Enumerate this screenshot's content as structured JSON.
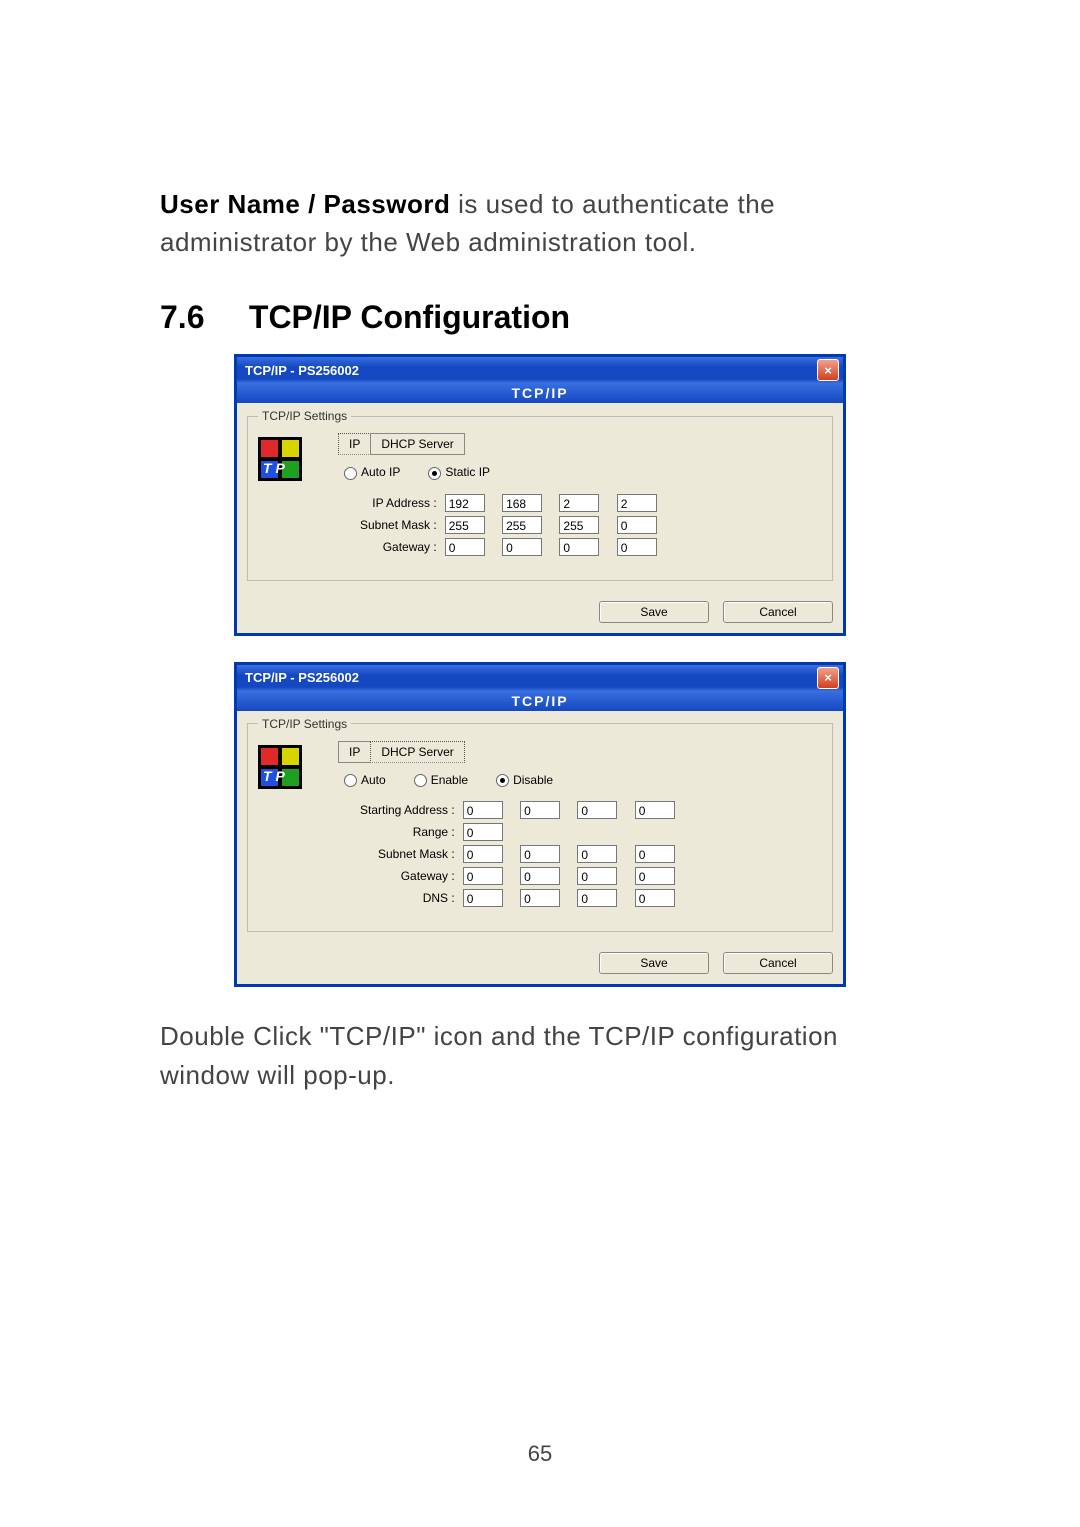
{
  "intro_bold": "User Name / Password",
  "intro_rest": " is used to authenticate the administrator by the Web administration tool.",
  "section": {
    "number": "7.6",
    "title": "TCP/IP Configuration"
  },
  "dialog1": {
    "title": "TCP/IP - PS256002",
    "close": "×",
    "header": "TCP/IP",
    "legend": "TCP/IP Settings",
    "tabs": [
      "IP",
      "DHCP Server"
    ],
    "active_tab": 0,
    "radios": [
      {
        "label": "Auto IP",
        "checked": false
      },
      {
        "label": "Static IP",
        "checked": true
      }
    ],
    "fields": [
      {
        "label": "IP Address :",
        "octets": [
          "192",
          "168",
          "2",
          "2"
        ]
      },
      {
        "label": "Subnet Mask :",
        "octets": [
          "255",
          "255",
          "255",
          "0"
        ]
      },
      {
        "label": "Gateway :",
        "octets": [
          "0",
          "0",
          "0",
          "0"
        ]
      }
    ],
    "save": "Save",
    "cancel": "Cancel"
  },
  "dialog2": {
    "title": "TCP/IP - PS256002",
    "close": "×",
    "header": "TCP/IP",
    "legend": "TCP/IP Settings",
    "tabs": [
      "IP",
      "DHCP Server"
    ],
    "active_tab": 1,
    "radios": [
      {
        "label": "Auto",
        "checked": false
      },
      {
        "label": "Enable",
        "checked": false
      },
      {
        "label": "Disable",
        "checked": true
      }
    ],
    "fields": [
      {
        "label": "Starting Address :",
        "octets": [
          "0",
          "0",
          "0",
          "0"
        ]
      },
      {
        "label": "Range :",
        "octets": [
          "0"
        ]
      },
      {
        "label": "Subnet Mask :",
        "octets": [
          "0",
          "0",
          "0",
          "0"
        ]
      },
      {
        "label": "Gateway :",
        "octets": [
          "0",
          "0",
          "0",
          "0"
        ]
      },
      {
        "label": "DNS :",
        "octets": [
          "0",
          "0",
          "0",
          "0"
        ]
      }
    ],
    "save": "Save",
    "cancel": "Cancel"
  },
  "outro": "Double Click \"TCP/IP\" icon and the TCP/IP configuration window will pop-up.",
  "page_number": "65",
  "icon_letters": "T P"
}
